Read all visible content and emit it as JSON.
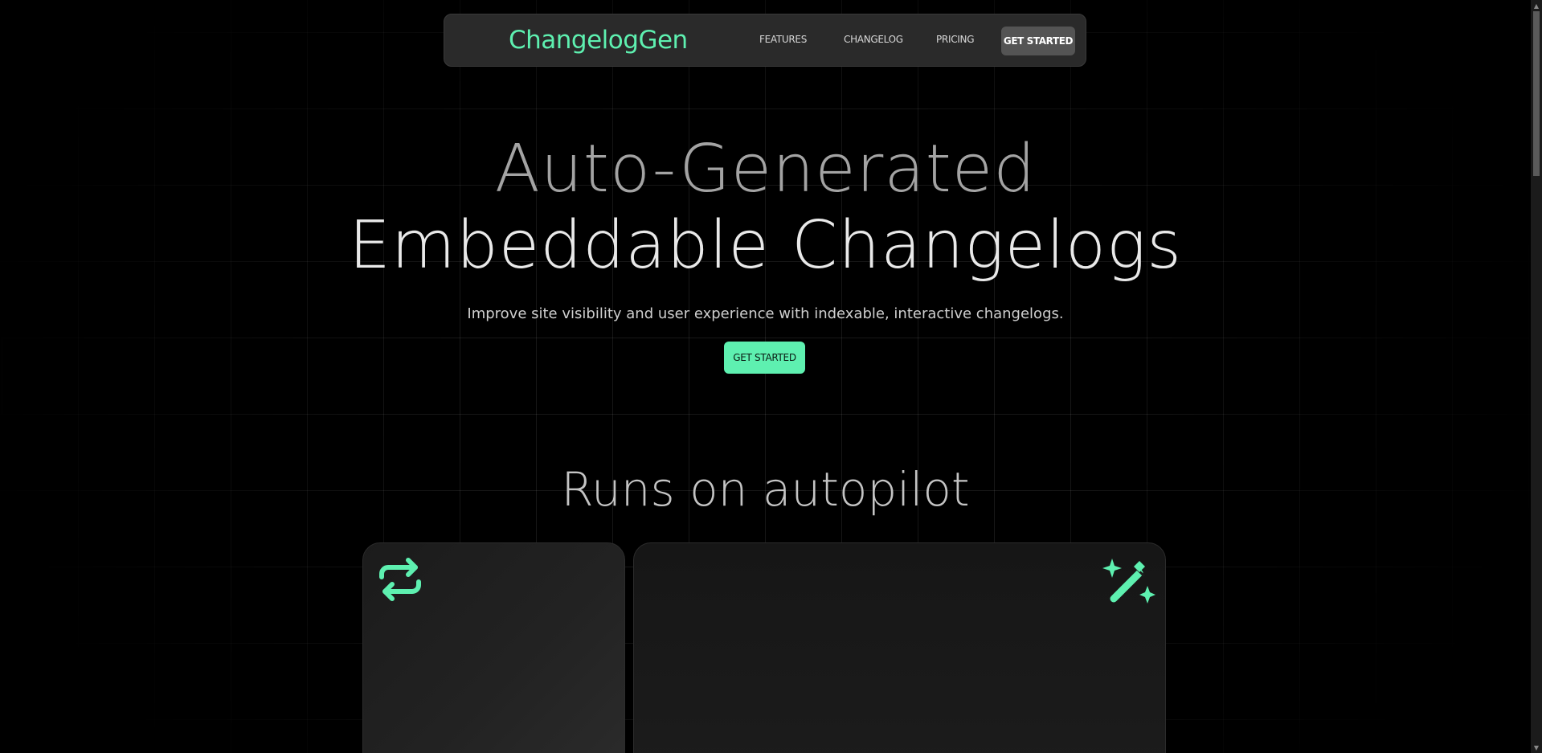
{
  "nav": {
    "brand": "ChangelogGen",
    "links": [
      "FEATURES",
      "CHANGELOG",
      "PRICING"
    ],
    "cta": "GET STARTED"
  },
  "hero": {
    "line1": "Auto-Generated",
    "line2": "Embeddable Changelogs",
    "subtitle": "Improve site visibility and user experience with indexable, interactive changelogs.",
    "cta": "GET STARTED"
  },
  "section": {
    "title": "Runs on autopilot"
  },
  "cards": [
    {
      "icon": "repeat-icon",
      "title": ""
    },
    {
      "icon": "magic-wand-icon",
      "title": ""
    }
  ],
  "colors": {
    "accent": "#5ef0b0",
    "background": "#000000",
    "nav_background": "#2a2a2a",
    "nav_cta_background": "#545454"
  }
}
